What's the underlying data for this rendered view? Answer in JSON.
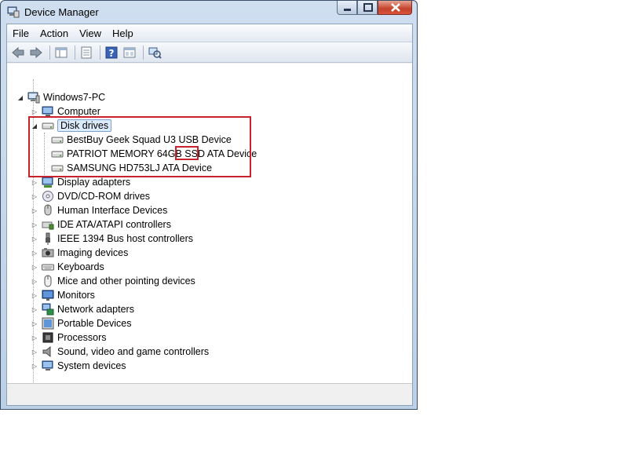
{
  "window": {
    "title": "Device Manager",
    "icon": "device-manager-icon",
    "caption": {
      "minimize": "minimize-icon",
      "maximize": "maximize-icon",
      "close": "close-icon"
    }
  },
  "menu": [
    {
      "label": "File",
      "accel": "F"
    },
    {
      "label": "Action",
      "accel": "A"
    },
    {
      "label": "View",
      "accel": "V"
    },
    {
      "label": "Help",
      "accel": "H"
    }
  ],
  "toolbar": [
    "back-arrow-icon",
    "forward-arrow-icon",
    "show-hide-console-tree-icon",
    "properties-icon",
    "help-icon",
    "console-view-icon",
    "scan-hardware-changes-icon"
  ],
  "tree": {
    "root": "Windows7-PC",
    "computer": "Computer",
    "disk_drives": {
      "label": "Disk drives",
      "children": [
        "BestBuy Geek Squad U3 USB Device",
        "PATRIOT MEMORY 64GB SSD ATA Device",
        "SAMSUNG HD753LJ ATA Device"
      ],
      "highlight_text": "SSD"
    },
    "categories": [
      "Display adapters",
      "DVD/CD-ROM drives",
      "Human Interface Devices",
      "IDE ATA/ATAPI controllers",
      "IEEE 1394 Bus host controllers",
      "Imaging devices",
      "Keyboards",
      "Mice and other pointing devices",
      "Monitors",
      "Network adapters",
      "Portable Devices",
      "Processors",
      "Sound, video and game controllers",
      "System devices"
    ]
  },
  "colors": {
    "annotation": "#c8232c",
    "selection": "#dcebfc"
  }
}
